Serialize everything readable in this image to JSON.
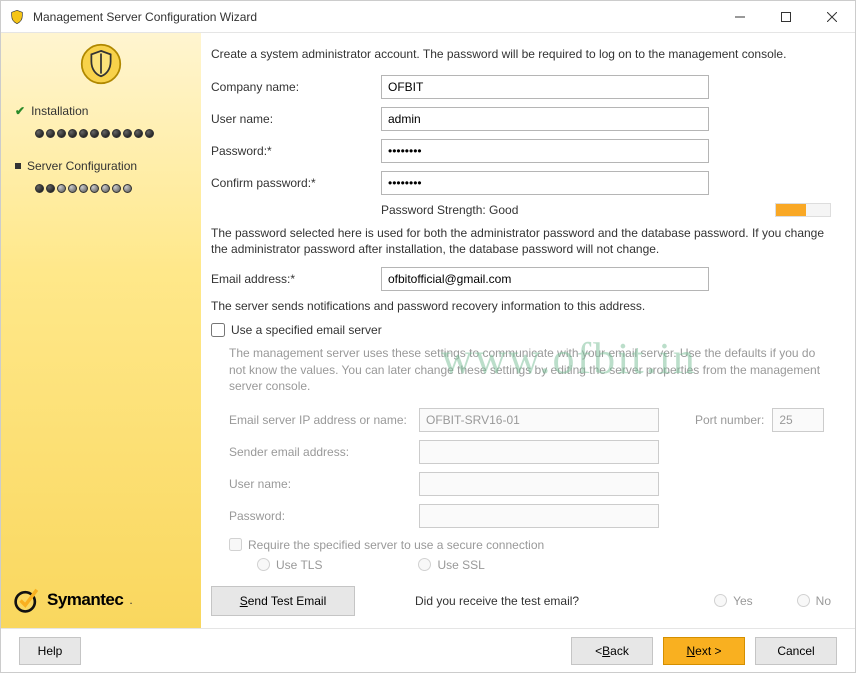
{
  "window": {
    "title": "Management Server Configuration Wizard",
    "minimize": "–",
    "maximize": "▢",
    "close": "✕"
  },
  "sidebar": {
    "steps": [
      {
        "label": "Installation",
        "dots_total": 11,
        "dots_filled": 11
      },
      {
        "label": "Server Configuration",
        "dots_total": 9,
        "dots_filled": 2
      }
    ],
    "brand": "Symantec",
    "brand_dot": "."
  },
  "main": {
    "intro": "Create a system administrator account. The password will be required to log on to the management console.",
    "labels": {
      "company": "Company name:",
      "user": "User name:",
      "password": "Password:*",
      "confirm": "Confirm password:*",
      "strength": "Password Strength: Good",
      "email": "Email address:*"
    },
    "values": {
      "company": "OFBIT",
      "user": "admin",
      "password": "••••••••",
      "confirm": "••••••••",
      "email": "ofbitofficial@gmail.com"
    },
    "notes": {
      "pw_note": "The password selected here is used for both the administrator password and the database password. If you change the administrator password after installation, the database password will not change.",
      "email_note": "The server sends notifications and password recovery information to this address."
    },
    "specified": {
      "label": "Use a specified email server",
      "inner_note": "The management server uses these settings to communicate with your email server.  Use the defaults if you do not know the values. You can later change these settings by editing the server properties from the management server console.",
      "ip_label": "Email server IP address or name:",
      "ip_value": "OFBIT-SRV16-01",
      "port_label": "Port number:",
      "port_value": "25",
      "sender_label": "Sender email address:",
      "user_label": "User name:",
      "pass_label": "Password:",
      "secure_label": "Require the specified server to use a secure connection",
      "tls": "Use TLS",
      "ssl": "Use SSL"
    },
    "test": {
      "button_prefix": "",
      "button_u": "S",
      "button_rest": "end Test Email",
      "question": "Did you receive the test email?",
      "yes": "Yes",
      "no": "No"
    }
  },
  "footer": {
    "help": "Help",
    "back_lt": "< ",
    "back_u": "B",
    "back_rest": "ack",
    "next_u": "N",
    "next_rest": "ext >",
    "cancel": "Cancel"
  },
  "watermark": "www.ofbit.in"
}
